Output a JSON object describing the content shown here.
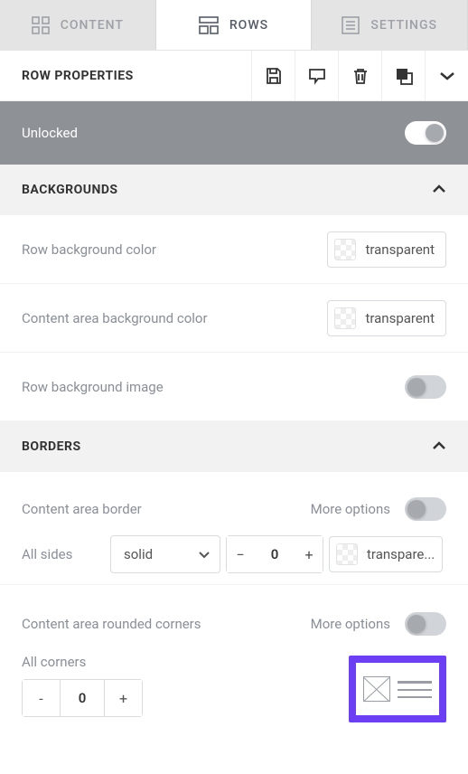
{
  "tabs": {
    "content": "CONTENT",
    "rows": "ROWS",
    "settings": "SETTINGS",
    "active": "rows"
  },
  "panel": {
    "title": "ROW PROPERTIES"
  },
  "lock": {
    "label": "Unlocked",
    "value": true
  },
  "sections": {
    "backgrounds": {
      "title": "BACKGROUNDS",
      "expanded": true,
      "row_bg_color": {
        "label": "Row background color",
        "value": "transparent"
      },
      "content_bg_color": {
        "label": "Content area background color",
        "value": "transparent"
      },
      "row_bg_image": {
        "label": "Row background image",
        "value": false
      }
    },
    "borders": {
      "title": "BORDERS",
      "expanded": true,
      "content_border_label": "Content area border",
      "more_options": "More options",
      "more_options_value": false,
      "all_sides_label": "All sides",
      "style": "solid",
      "width": 0,
      "color": "transpare..."
    },
    "corners": {
      "label": "Content area rounded corners",
      "more_options": "More options",
      "more_options_value": false,
      "all_corners_label": "All corners",
      "radius": 0
    }
  }
}
